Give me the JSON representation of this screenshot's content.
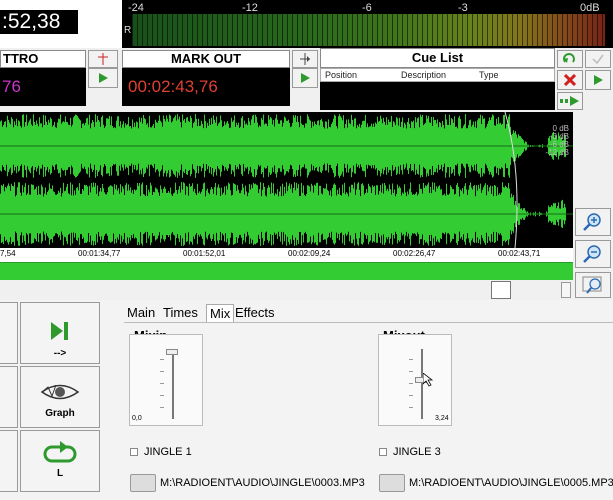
{
  "top": {
    "time_partial": ":52,38",
    "meter_scale": [
      "-24",
      "-12",
      "-6",
      "-3",
      "0dB"
    ],
    "meter_channel": "R"
  },
  "intro_panel": {
    "label": "TTRO",
    "time": "76",
    "time_color": "#cc33cc"
  },
  "markout_panel": {
    "label": "MARK OUT",
    "time": "00:02:43,76",
    "time_color": "#e04030"
  },
  "cue_list": {
    "title": "Cue List",
    "columns": [
      "Position",
      "Description",
      "Type"
    ]
  },
  "waveform": {
    "db_labels": [
      "0 dB",
      "-3 dB",
      "-6 dB",
      "-12 dB"
    ],
    "wave_color": "#33cc33",
    "timeline": [
      "7,54",
      "00:01:34,77",
      "00:01:52,01",
      "00:02:09,24",
      "00:02:26,47",
      "00:02:43,71"
    ]
  },
  "bottom": {
    "buttons": [
      {
        "label": "-->",
        "icon": "skip-to-end-icon"
      },
      {
        "label": "Graph",
        "icon": "eye-graph-icon"
      },
      {
        "label": "L",
        "icon": "loop-icon"
      }
    ],
    "tabs": [
      "Main",
      "Times",
      "Mix",
      "Effects"
    ],
    "active_tab": "Mix",
    "mixin": {
      "title": "Mixin",
      "value": "0,0",
      "jingle": "JINGLE 1",
      "path": "M:\\RADIOENT\\AUDIO\\JINGLE\\0003.MP3",
      "level": 1.0
    },
    "mixout": {
      "title": "Mixout",
      "value": "3,24",
      "jingle": "JINGLE 3",
      "path": "M:\\RADIOENT\\AUDIO\\JINGLE\\0005.MP3",
      "level": 0.57
    }
  }
}
